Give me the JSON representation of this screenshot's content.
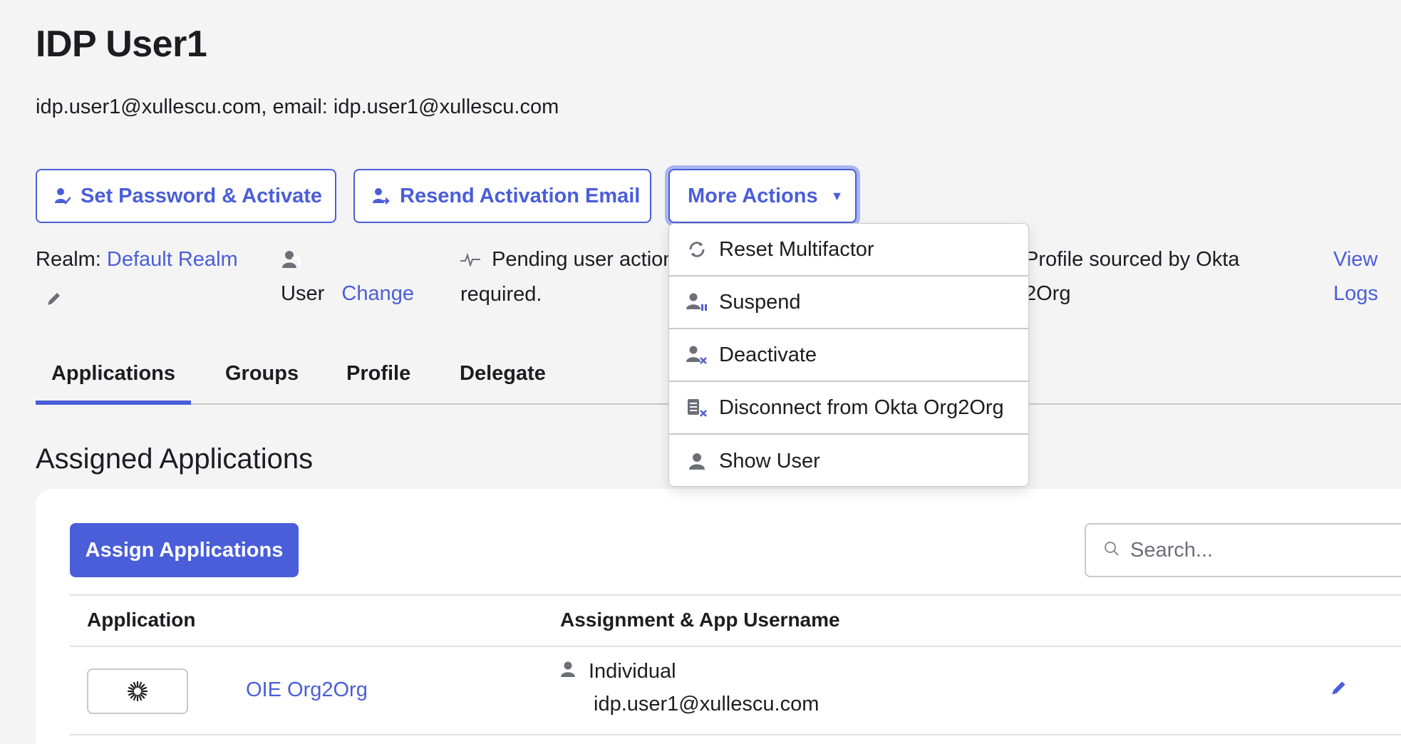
{
  "header": {
    "title": "IDP User1",
    "subtitle": "idp.user1@xullescu.com, email: idp.user1@xullescu.com"
  },
  "actions": {
    "set_password": "Set Password & Activate",
    "resend": "Resend Activation Email",
    "more": "More Actions",
    "more_caret": "▼"
  },
  "meta": {
    "realm_label": "Realm:",
    "realm_value": "Default Realm",
    "user_type": "User",
    "change": "Change",
    "pending_line1": "Pending user action",
    "pending_line2": "required.",
    "profile_line1": "Profile sourced by Okta",
    "profile_line2": "2Org",
    "logs_line1": "View",
    "logs_line2": "Logs"
  },
  "tabs": [
    "Applications",
    "Groups",
    "Profile",
    "Delegate"
  ],
  "assigned": {
    "title": "Assigned Applications",
    "assign_button": "Assign Applications",
    "search_placeholder": "Search...",
    "columns": [
      "Application",
      "Assignment & App Username"
    ],
    "rows": [
      {
        "app": "OIE Org2Org",
        "assignment": "Individual",
        "username": "idp.user1@xullescu.com"
      }
    ]
  },
  "menu": {
    "items": [
      "Reset Multifactor",
      "Suspend",
      "Deactivate",
      "Disconnect from Okta Org2Org",
      "Show User"
    ]
  },
  "colors": {
    "accent": "#4a5ed9",
    "background": "#f4f4f4",
    "icon_gray": "#6e6e78"
  }
}
